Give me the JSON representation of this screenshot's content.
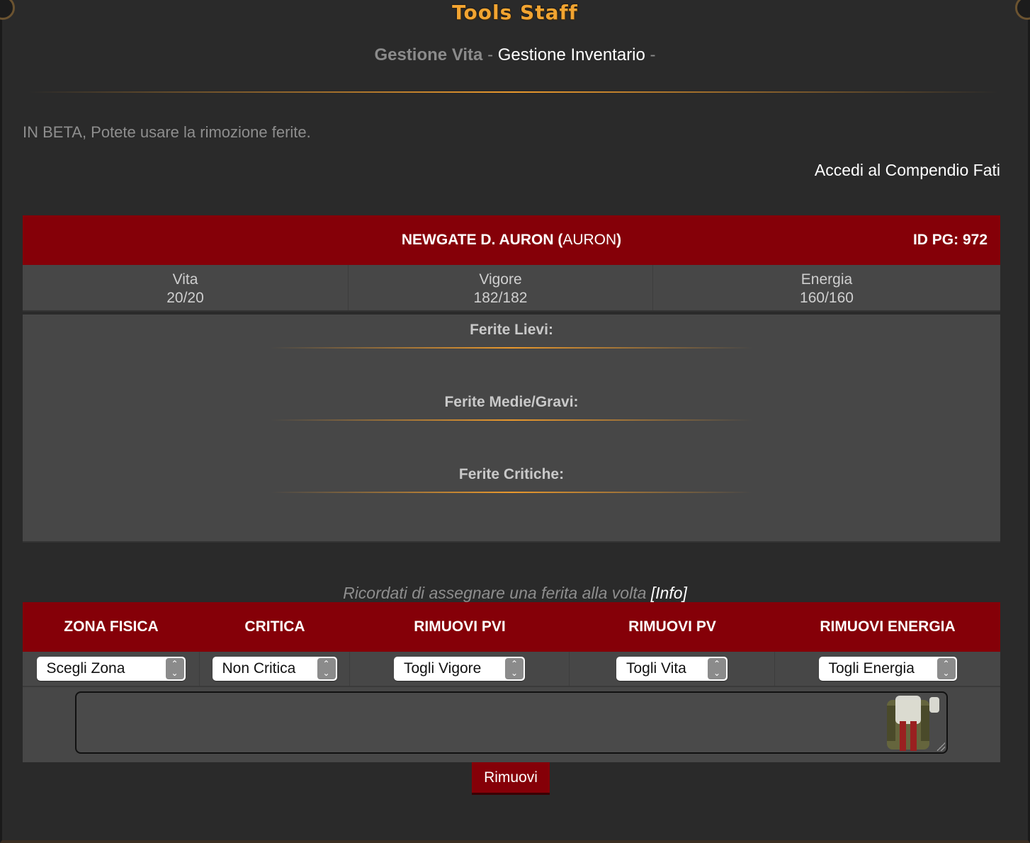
{
  "header": {
    "title": "Tools Staff",
    "nav_vita": "Gestione Vita",
    "nav_sep1": " - ",
    "nav_inventario": "Gestione Inventario",
    "nav_sep2": " -"
  },
  "notice": "IN BETA, Potete usare la rimozione ferite.",
  "compendio_link": "Accedi al Compendio Fati",
  "character": {
    "name": "NEWGATE D. AURON",
    "nick_open": " (",
    "nick": "AURON",
    "nick_close": ")",
    "id_label": "ID PG: 972"
  },
  "stats": [
    {
      "label": "Vita",
      "value": "20/20"
    },
    {
      "label": "Vigore",
      "value": "182/182"
    },
    {
      "label": "Energia",
      "value": "160/160"
    }
  ],
  "wounds": {
    "lievi": "Ferite Lievi:",
    "medie": "Ferite Medie/Gravi:",
    "critiche": "Ferite Critiche:"
  },
  "reminder": {
    "text": "Ricordati di assegnare una ferita alla volta ",
    "info": "[Info]"
  },
  "form": {
    "columns": [
      "ZONA FISICA",
      "CRITICA",
      "RIMUOVI PVI",
      "RIMUOVI PV",
      "RIMUOVI ENERGIA"
    ],
    "selects": [
      "Scegli Zona",
      "Non Critica",
      "Togli Vigore",
      "Togli Vita",
      "Togli Energia"
    ],
    "submit": "Rimuovi"
  },
  "colors": {
    "accent_red": "#850008",
    "gold": "#f2a431",
    "panel": "#474747",
    "background": "#2a2a2a"
  }
}
